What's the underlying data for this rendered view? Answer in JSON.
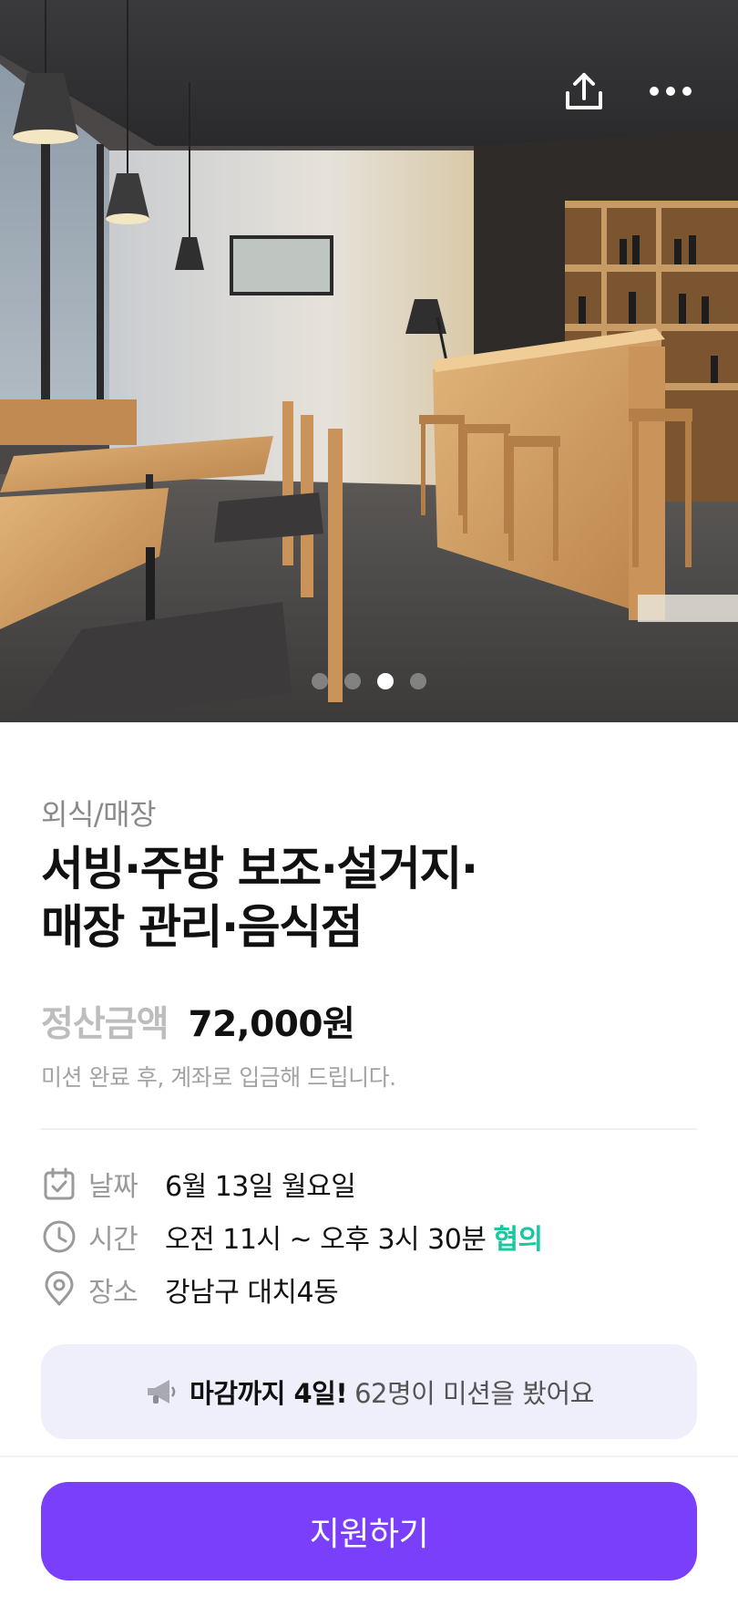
{
  "hero": {
    "slides_total": 4,
    "active_slide": 3,
    "share_icon": "upload-share-icon",
    "more_icon": "more-horizontal-icon"
  },
  "job": {
    "category": "외식/매장",
    "title_line1": "서빙·주방 보조·설거지·",
    "title_line2": "매장 관리·음식점",
    "pay_label": "정산금액",
    "pay_amount": "72,000원",
    "pay_note": "미션 완료 후, 계좌로 입금해 드립니다."
  },
  "info": {
    "date": {
      "label": "날짜",
      "value": "6월 13일 월요일",
      "icon": "calendar-check-icon"
    },
    "time": {
      "label": "시간",
      "value": "오전 11시 ~ 오후 3시 30분",
      "tag": "협의",
      "icon": "clock-icon"
    },
    "place": {
      "label": "장소",
      "value": "강남구 대치4동",
      "icon": "location-pin-icon"
    }
  },
  "notice": {
    "icon": "megaphone-icon",
    "strong": "마감까지 4일!",
    "rest": "62명이 미션을 봤어요"
  },
  "cta": {
    "apply_label": "지원하기"
  },
  "colors": {
    "accent": "#7a3ffa",
    "negotiable": "#19c7a0",
    "notice_bg": "#efeffc"
  }
}
